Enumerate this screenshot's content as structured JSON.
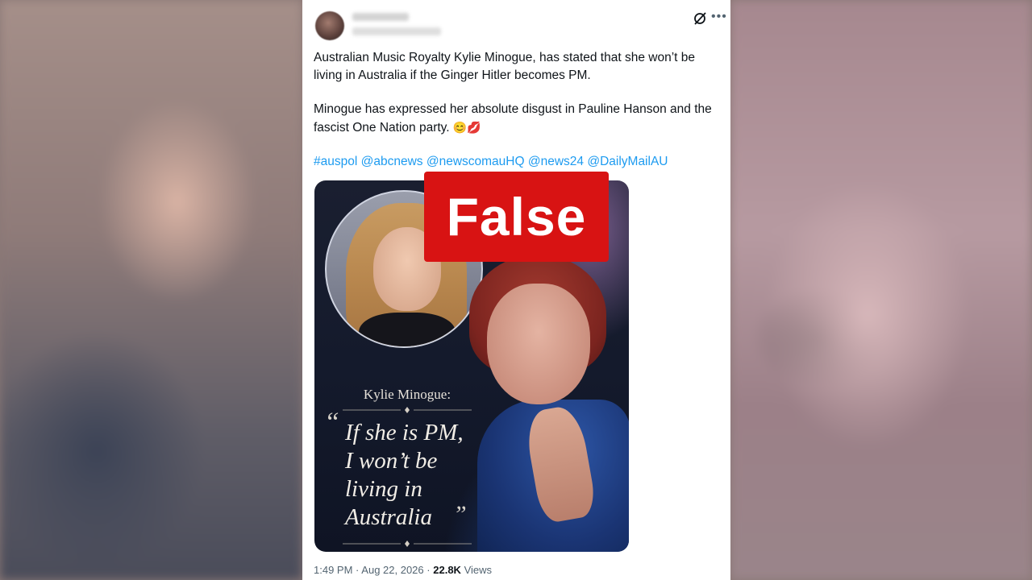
{
  "tweet": {
    "text_para1": "Australian Music Royalty Kylie Minogue,  has stated that she won’t be living in Australia if the Ginger Hitler becomes PM.",
    "text_para2": "Minogue has expressed her absolute disgust in Pauline Hanson and the fascist One Nation party.",
    "emoji": "😊💋",
    "hashtags": [
      "#auspol",
      "@abcnews",
      "@newscomauHQ",
      "@news24",
      "@DailyMailAU"
    ],
    "time": "1:49 PM",
    "date": "Aug 22, 2026",
    "separator": "·",
    "views_count": "22.8K",
    "views_label": "Views"
  },
  "media": {
    "quote_name": "Kylie Minogue:",
    "quote_lines": [
      "If she is PM,",
      "I won’t be",
      "living in",
      "Australia"
    ],
    "quote_open": "“",
    "quote_close": "”"
  },
  "badge": {
    "label": "False",
    "color": "#d81313"
  },
  "icons": {
    "grok": "grok-icon",
    "more": "more-icon"
  },
  "colors": {
    "link": "#1d9bf0",
    "text": "#0f1419",
    "muted": "#536471"
  }
}
